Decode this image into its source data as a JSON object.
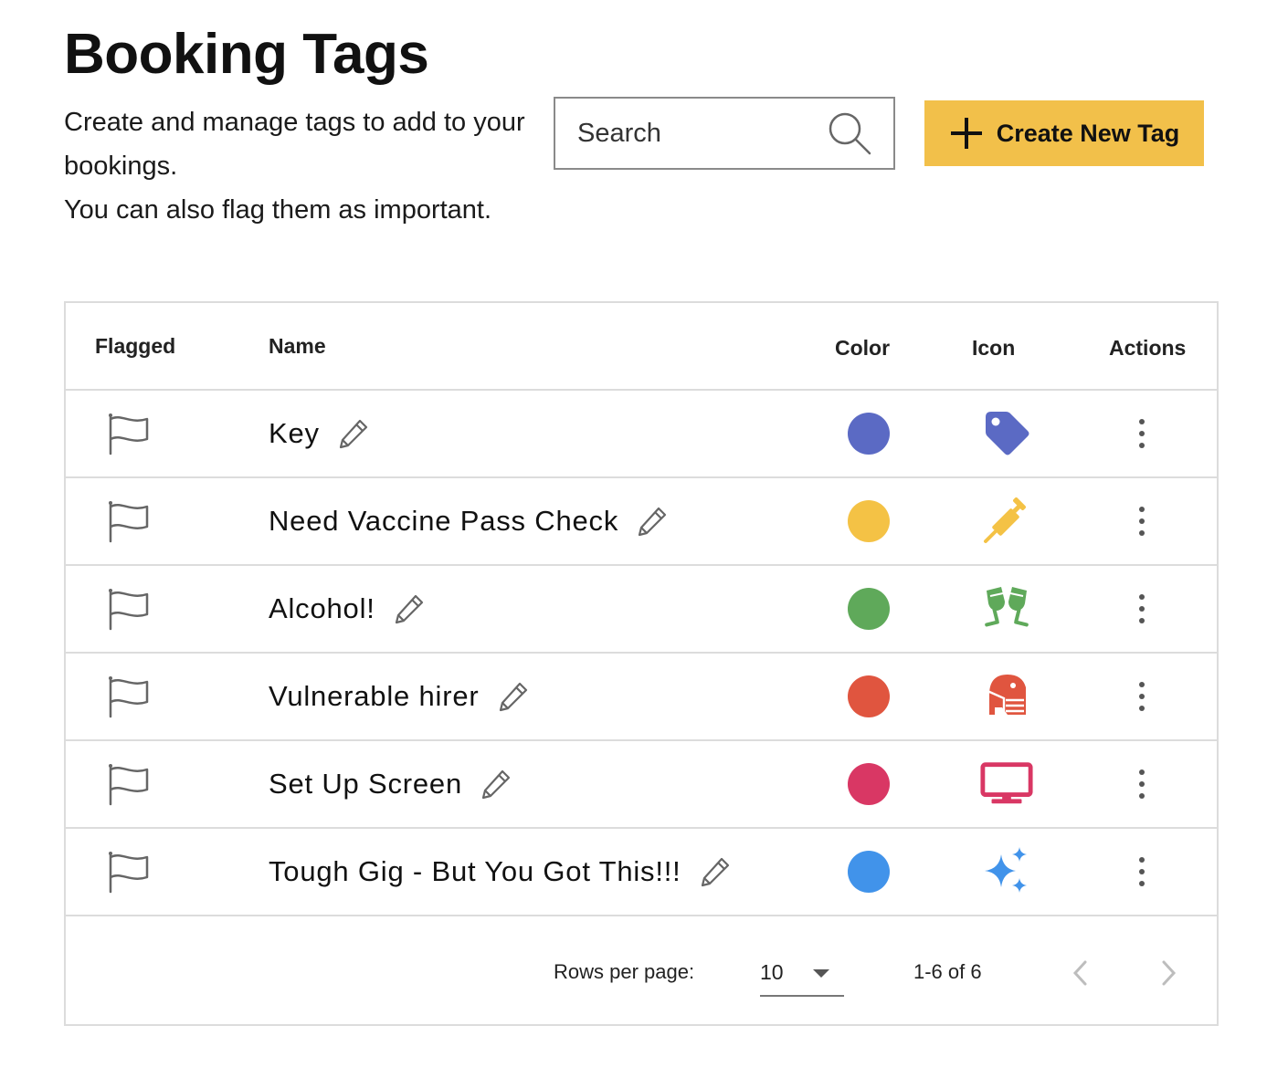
{
  "header": {
    "title": "Booking Tags",
    "description_line1": "Create and manage tags to add to your bookings.",
    "description_line2": "You can also flag them as important."
  },
  "search": {
    "placeholder": "Search",
    "value": ""
  },
  "create_button": {
    "label": "Create New Tag",
    "icon": "plus-icon"
  },
  "table": {
    "columns": [
      "Flagged",
      "Name",
      "Color",
      "Icon",
      "Actions"
    ],
    "rows": [
      {
        "flagged": false,
        "name": "Key",
        "color": "#5b6ac4",
        "icon": "tag-icon"
      },
      {
        "flagged": false,
        "name": "Need Vaccine Pass Check",
        "color": "#f4c245",
        "icon": "syringe-icon"
      },
      {
        "flagged": false,
        "name": "Alcohol!",
        "color": "#5fa95a",
        "icon": "glasses-cheers-icon"
      },
      {
        "flagged": false,
        "name": "Vulnerable hirer",
        "color": "#e0553f",
        "icon": "head-side-mask-icon"
      },
      {
        "flagged": false,
        "name": "Set Up Screen",
        "color": "#d93764",
        "icon": "monitor-icon"
      },
      {
        "flagged": false,
        "name": "Tough Gig - But You Got This!!!",
        "color": "#4193ea",
        "icon": "sparkles-icon"
      }
    ]
  },
  "pagination": {
    "rows_per_page_label": "Rows per page:",
    "rows_per_page_value": "10",
    "range_text": "1-6 of 6"
  }
}
